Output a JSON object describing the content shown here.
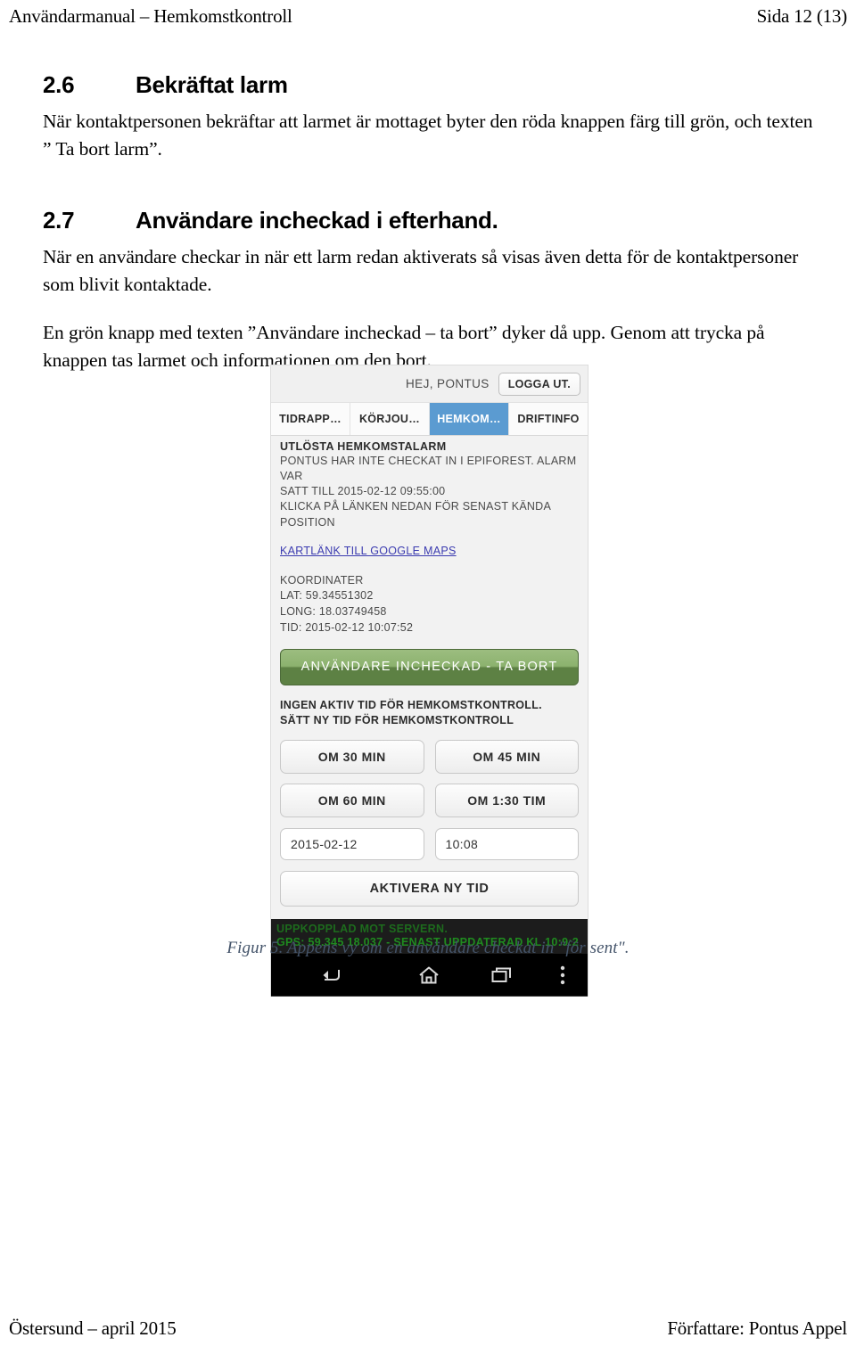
{
  "header": {
    "left": "Användarmanual – Hemkomstkontroll",
    "right": "Sida 12 (13)"
  },
  "sections": [
    {
      "number": "2.6",
      "title": "Bekräftat larm",
      "paragraphs": [
        "När kontaktpersonen bekräftar att larmet är mottaget byter den röda knappen färg till grön, och texten ” Ta bort larm”."
      ]
    },
    {
      "number": "2.7",
      "title": "Användare incheckad i efterhand.",
      "paragraphs": [
        "När en användare checkar in när ett larm redan aktiverats så visas även detta för de kontaktpersoner som blivit kontaktade.",
        "En grön knapp med texten ”Användare incheckad – ta bort” dyker då upp. Genom att trycka på knappen tas larmet och informationen om den bort."
      ]
    }
  ],
  "screenshot": {
    "app": {
      "greeting": "HEJ, PONTUS",
      "logout_label": "LOGGA UT.",
      "tabs": [
        {
          "label": "TIDRAPP…",
          "active": false
        },
        {
          "label": "KÖRJOU…",
          "active": false
        },
        {
          "label": "HEMKOM…",
          "active": true
        },
        {
          "label": "DRIFTINFO",
          "active": false
        }
      ],
      "alarm": {
        "title": "UTLÖSTA HEMKOMSTALARM",
        "line1": "PONTUS HAR INTE CHECKAT IN I EPIFOREST. ALARM VAR",
        "line2": "SATT TILL 2015-02-12 09:55:00",
        "line3": "KLICKA PÅ LÄNKEN NEDAN FÖR SENAST KÄNDA POSITION",
        "map_link": "KARTLÄNK TILL GOOGLE MAPS"
      },
      "coordinates": {
        "title": "KOORDINATER",
        "lat": "LAT: 59.34551302",
        "long": "LONG: 18.03749458",
        "time": "TID: 2015-02-12 10:07:52"
      },
      "remove_button_label": "ANVÄNDARE INCHECKAD - TA BORT",
      "notice": {
        "line1": "INGEN AKTIV TID FÖR HEMKOMSTKONTROLL.",
        "line2": "SÄTT NY TID FÖR HEMKOMSTKONTROLL"
      },
      "preset_buttons": [
        "OM 30 MIN",
        "OM 45 MIN",
        "OM 60 MIN",
        "OM 1:30 TIM"
      ],
      "date_value": "2015-02-12",
      "time_value": "10:08",
      "activate_button_label": "AKTIVERA NY TID",
      "status": {
        "line1": "UPPKOPPLAD MOT SERVERN.",
        "line2": "GPS: 59.345 18.037 - SENAST UPPDATERAD KL 10:9:2"
      },
      "navbar": {
        "back": "back-icon",
        "home": "home-icon",
        "recents": "recent-apps-icon",
        "more": "overflow-menu-icon"
      },
      "colors": {
        "active_tab": "#5b9bd1",
        "green_button_top": "#9cbd80",
        "green_button_bottom": "#5d8144",
        "status_text": "#1f8a1f",
        "link": "#3b3bb0"
      }
    }
  },
  "caption": "Figur 5. Appens vy om en användare checkat in \"för sent\".",
  "footer": {
    "left": "Östersund – april 2015",
    "right": "Författare: Pontus Appel"
  }
}
